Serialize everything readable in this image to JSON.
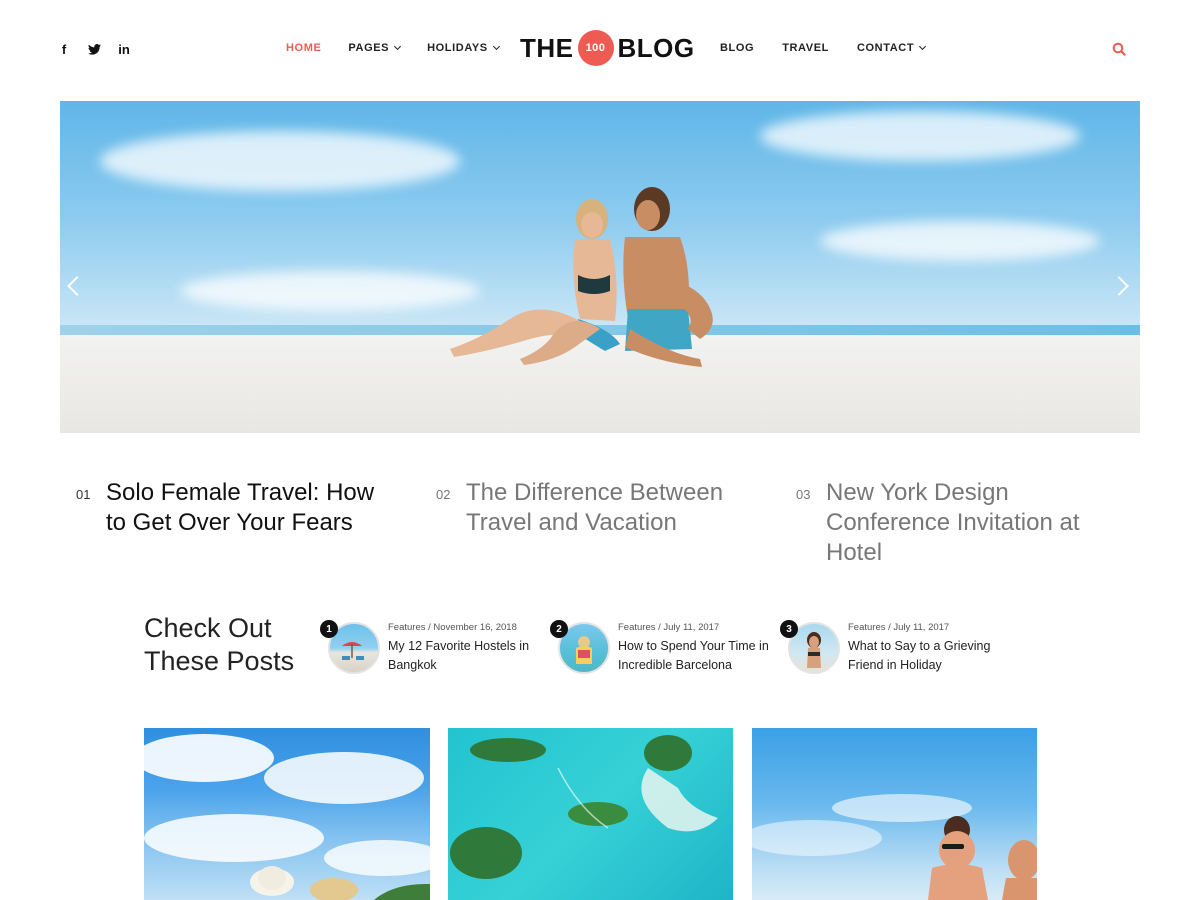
{
  "header": {
    "social": [
      "facebook-icon",
      "twitter-icon",
      "linkedin-icon"
    ],
    "nav_left": [
      {
        "label": "HOME",
        "active": true,
        "dropdown": false
      },
      {
        "label": "PAGES",
        "active": false,
        "dropdown": true
      },
      {
        "label": "HOLIDAYS",
        "active": false,
        "dropdown": true
      }
    ],
    "logo": {
      "left": "THE",
      "badge": "100",
      "right": "BLOG"
    },
    "nav_right": [
      {
        "label": "BLOG",
        "dropdown": false
      },
      {
        "label": "TRAVEL",
        "dropdown": false
      },
      {
        "label": "CONTACT",
        "dropdown": true
      }
    ],
    "search_icon": "search-icon"
  },
  "colors": {
    "accent": "#ef5b52",
    "text": "#1a1a1a",
    "muted": "#777777"
  },
  "featured": [
    {
      "num": "01",
      "title": "Solo Female Travel: How to Get Over Your Fears"
    },
    {
      "num": "02",
      "title": "The Difference Between Travel and Vacation"
    },
    {
      "num": "03",
      "title": "New York Design Conference Invitation at Hotel"
    }
  ],
  "check": {
    "title_line1": "Check Out",
    "title_line2": "These Posts",
    "posts": [
      {
        "rank": "1",
        "meta": "Features / November 16, 2018",
        "title": "My 12 Favorite Hostels in Bangkok"
      },
      {
        "rank": "2",
        "meta": "Features / July 11, 2017",
        "title": "How to Spend Your Time in Incredible Barcelona"
      },
      {
        "rank": "3",
        "meta": "Features / July 11, 2017",
        "title": "What to Say to a Grieving Friend in Holiday"
      }
    ]
  }
}
